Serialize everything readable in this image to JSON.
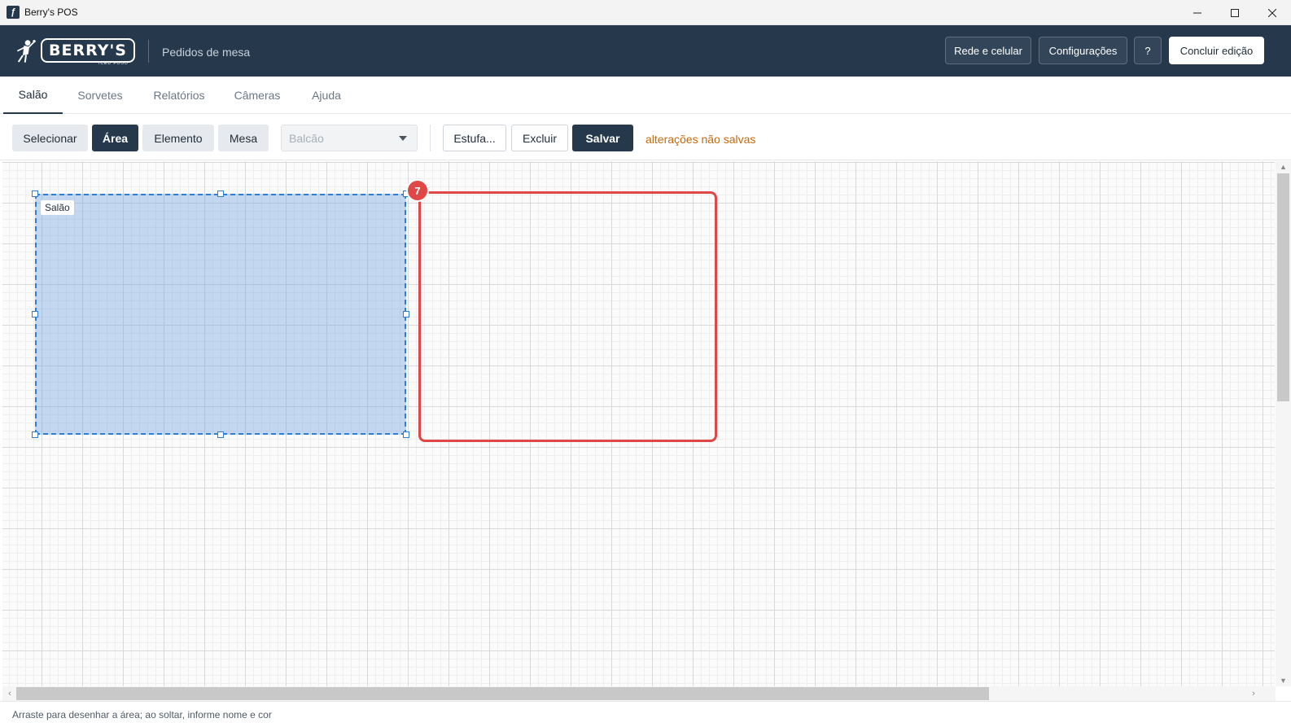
{
  "window": {
    "title": "Berry's POS"
  },
  "header": {
    "logo_text": "BERRY'S",
    "logo_sub": "ICED FOOD",
    "subtitle": "Pedidos de mesa",
    "buttons": {
      "network": "Rede e celular",
      "settings": "Configurações",
      "help": "?",
      "finish": "Concluir edição"
    }
  },
  "tabs": [
    "Salão",
    "Sorvetes",
    "Relatórios",
    "Câmeras",
    "Ajuda"
  ],
  "toolbar": {
    "select": "Selecionar",
    "area": "Área",
    "element": "Elemento",
    "table": "Mesa",
    "dropdown_value": "Balcão",
    "stove": "Estufa...",
    "delete": "Excluir",
    "save": "Salvar",
    "unsaved": "alterações não salvas"
  },
  "canvas": {
    "area_label": "Salão",
    "badge": "7"
  },
  "status": "Arraste para desenhar a área; ao soltar, informe nome e cor",
  "colors": {
    "header_bg": "#26394c",
    "accent_blue": "#2e7fd0",
    "alert_red": "#e04848",
    "warning_orange": "#c46a0a"
  },
  "icons": {
    "app": "app-icon",
    "minimize": "minimize-icon",
    "maximize": "maximize-icon",
    "close": "close-icon",
    "dropdown": "chevron-down-icon"
  }
}
